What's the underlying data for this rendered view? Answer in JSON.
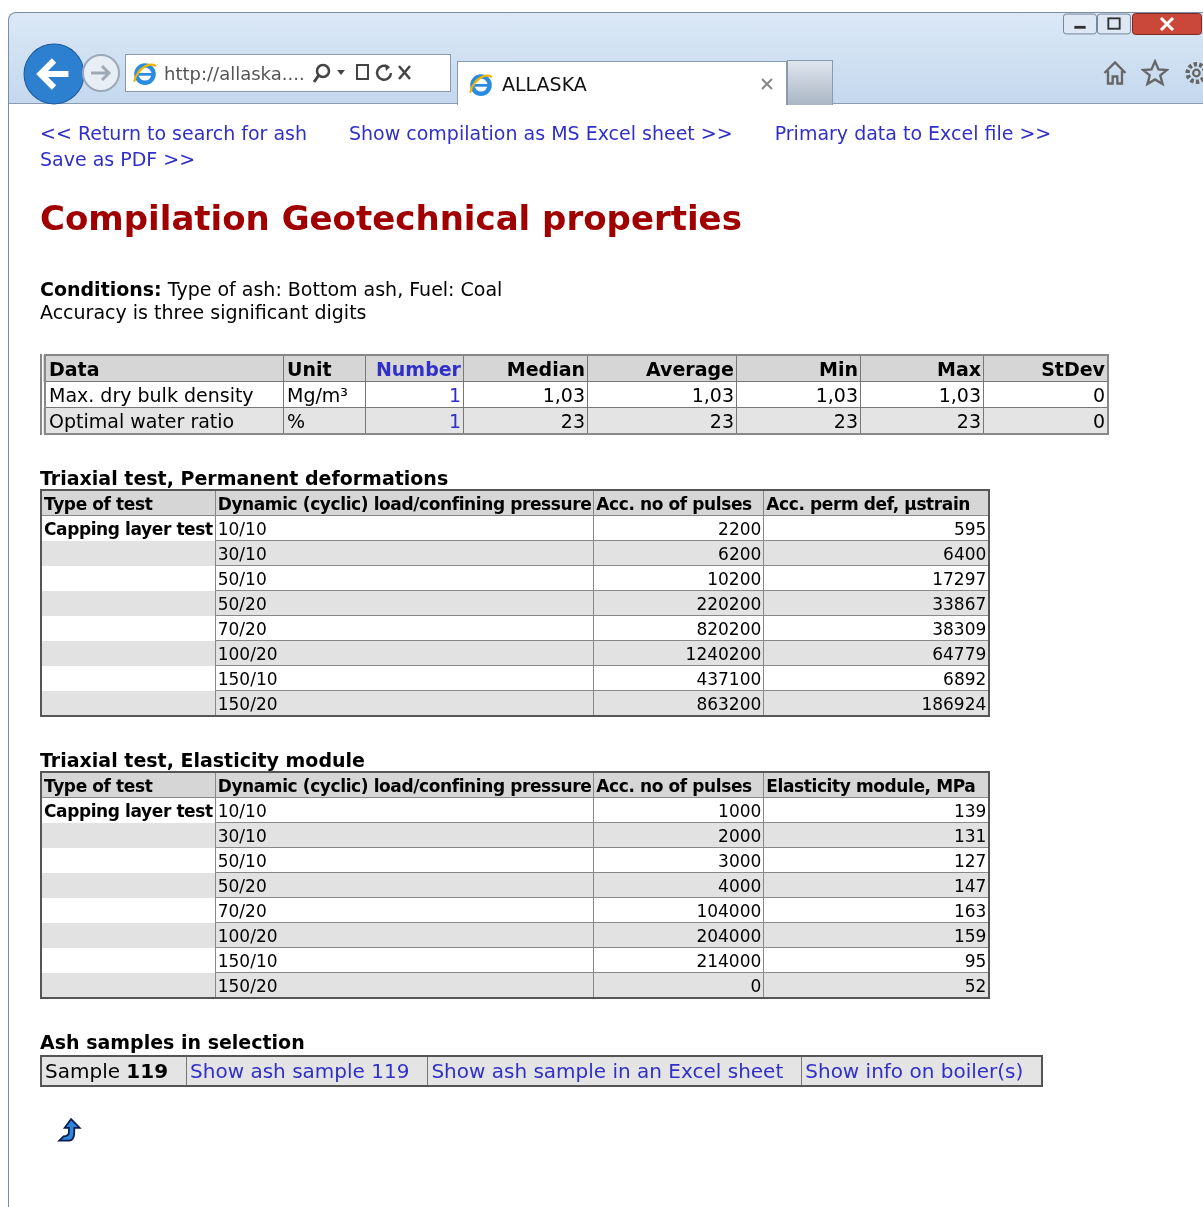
{
  "browser": {
    "address": "http://allaska....",
    "tab_title": "ALLASKA"
  },
  "links": [
    "<< Return to search for ash",
    "Show compilation as MS Excel sheet >>",
    "Primary data to Excel file >>",
    "Save as PDF >>"
  ],
  "title": "Compilation Geotechnical properties",
  "conditions": "**Conditions:** Type of ash: Bottom ash, Fuel: Coal",
  "accuracy": "Accuracy is three significant digits",
  "summary_table": {
    "columns": [
      {
        "label": "Data",
        "kind": "text"
      },
      {
        "label": "Unit",
        "kind": "text"
      },
      {
        "label": "Number",
        "kind": "link"
      },
      {
        "label": "Median",
        "kind": "number"
      },
      {
        "label": "Average",
        "kind": "number"
      },
      {
        "label": "Min",
        "kind": "number"
      },
      {
        "label": "Max",
        "kind": "number"
      },
      {
        "label": "StDev",
        "kind": "number"
      }
    ],
    "rows": [
      [
        "Max. dry bulk density",
        "Mg/m³",
        "1",
        "1,03",
        "1,03",
        "1,03",
        "1,03",
        "0"
      ],
      [
        "Optimal water ratio",
        "%",
        "1",
        "23",
        "23",
        "23",
        "23",
        "0"
      ]
    ]
  },
  "triaxial_tables": [
    {
      "title": "Triaxial test, Permanent deformations",
      "columns": [
        "Type of test",
        "Dynamic (cyclic) load/confining pressure",
        "Acc. no of pulses",
        "Acc. perm def, µstrain"
      ],
      "rows": [
        [
          "Capping layer test",
          "10/10",
          "2200",
          "595"
        ],
        [
          "",
          "30/10",
          "6200",
          "6400"
        ],
        [
          "",
          "50/10",
          "10200",
          "17297"
        ],
        [
          "",
          "50/20",
          "220200",
          "33867"
        ],
        [
          "",
          "70/20",
          "820200",
          "38309"
        ],
        [
          "",
          "100/20",
          "1240200",
          "64779"
        ],
        [
          "",
          "150/10",
          "437100",
          "6892"
        ],
        [
          "",
          "150/20",
          "863200",
          "186924"
        ]
      ]
    },
    {
      "title": "Triaxial test, Elasticity module",
      "columns": [
        "Type of test",
        "Dynamic (cyclic) load/confining pressure",
        "Acc. no of pulses",
        "Elasticity module, MPa"
      ],
      "rows": [
        [
          "Capping layer test",
          "10/10",
          "1000",
          "139"
        ],
        [
          "",
          "30/10",
          "2000",
          "131"
        ],
        [
          "",
          "50/10",
          "3000",
          "127"
        ],
        [
          "",
          "50/20",
          "4000",
          "147"
        ],
        [
          "",
          "70/20",
          "104000",
          "163"
        ],
        [
          "",
          "100/20",
          "204000",
          "159"
        ],
        [
          "",
          "150/10",
          "214000",
          "95"
        ],
        [
          "",
          "150/20",
          "0",
          "52"
        ]
      ]
    }
  ],
  "samples": {
    "title": "Ash samples in selection",
    "label": "Sample **119**",
    "links": [
      "Show ash sample 119",
      "Show ash sample in an Excel sheet",
      "Show info on boiler(s)"
    ]
  }
}
